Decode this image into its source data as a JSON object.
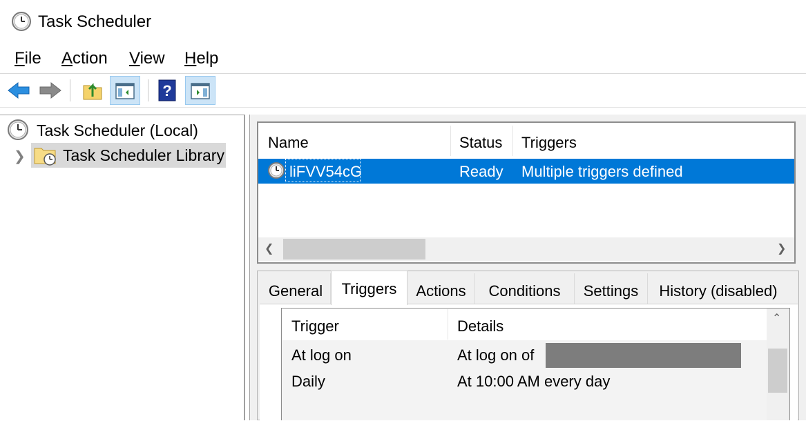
{
  "window": {
    "title": "Task Scheduler",
    "icon": "clock-icon"
  },
  "menu": [
    {
      "accel": "F",
      "rest": "ile"
    },
    {
      "accel": "A",
      "rest": "ction"
    },
    {
      "accel": "V",
      "rest": "iew"
    },
    {
      "accel": "H",
      "rest": "elp"
    }
  ],
  "toolbar": {
    "buttons": [
      "back-arrow-icon",
      "forward-arrow-icon",
      "up-folder-icon",
      "show-hide-console-tree-icon",
      "help-icon",
      "show-hide-action-pane-icon"
    ]
  },
  "tree": {
    "root": "Task Scheduler (Local)",
    "library": "Task Scheduler Library"
  },
  "task_list": {
    "columns": [
      "Name",
      "Status",
      "Triggers"
    ],
    "rows": [
      {
        "name": "liFVV54cG",
        "status": "Ready",
        "triggers": "Multiple triggers defined"
      }
    ]
  },
  "details": {
    "tabs": [
      "General",
      "Triggers",
      "Actions",
      "Conditions",
      "Settings",
      "History (disabled)"
    ],
    "selected_tab": "Triggers",
    "triggers_table": {
      "columns": [
        "Trigger",
        "Details"
      ],
      "rows": [
        {
          "trigger": "At log on",
          "details": "At log on of"
        },
        {
          "trigger": "Daily",
          "details": "At 10:00 AM every day"
        }
      ]
    }
  },
  "colors": {
    "selection": "#0078d7",
    "toolbar_active": "#cce4f7",
    "redaction": "#7d7d7d"
  }
}
